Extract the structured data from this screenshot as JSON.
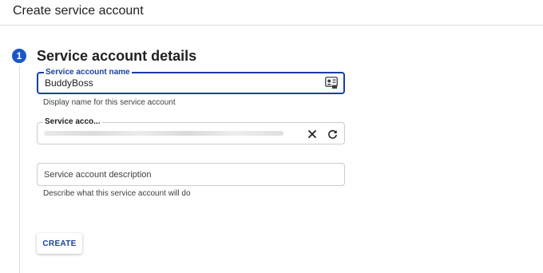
{
  "header": {
    "title": "Create service account"
  },
  "step": {
    "number": "1",
    "title": "Service account details"
  },
  "fields": {
    "name": {
      "label": "Service account name",
      "value": "BuddyBoss",
      "helper": "Display name for this service account"
    },
    "id": {
      "label": "Service acco...",
      "value_redacted": true
    },
    "description": {
      "placeholder": "Service account description",
      "helper": "Describe what this service account will do"
    }
  },
  "icons": {
    "name_field": "contact-card-icon",
    "clear": "close-icon",
    "refresh": "refresh-icon"
  },
  "actions": {
    "create_label": "CREATE"
  },
  "colors": {
    "accent": "#1a3fa3",
    "step_badge": "#1a56c9",
    "border": "#c9ccd1"
  }
}
